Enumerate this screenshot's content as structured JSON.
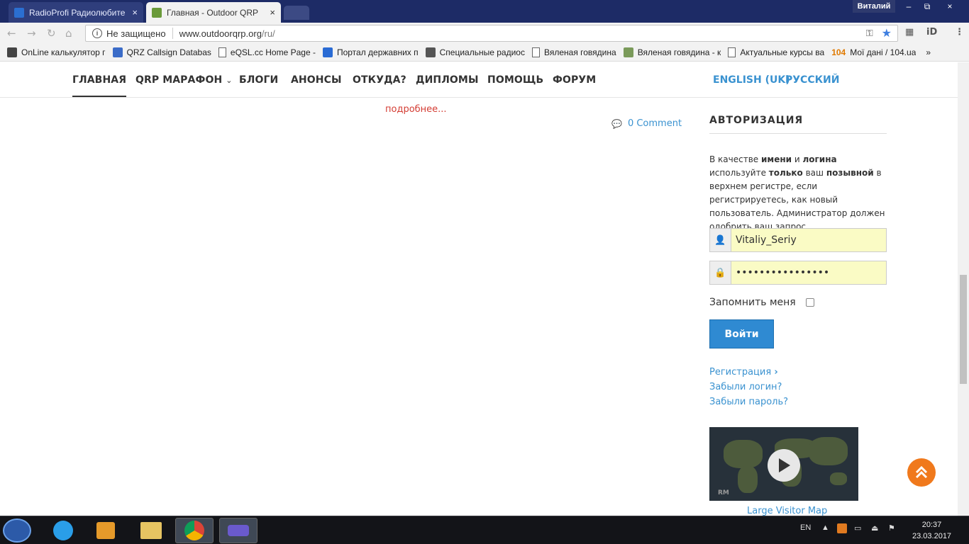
{
  "browser": {
    "tabs": [
      {
        "title": "RadioProfi Радиолюбите",
        "close": "×"
      },
      {
        "title": "Главная - Outdoor QRP",
        "close": "×"
      }
    ],
    "profile_name": "Виталий",
    "window_controls": [
      "–",
      "⧉",
      "×"
    ],
    "security_label": "Не защищено",
    "url_host": "www.outdoorqrp.org",
    "url_path": "/ru/",
    "bookmarks": [
      "OnLine калькулятор г",
      "QRZ Callsign Databas",
      "eQSL.cc Home Page -",
      "Портал державних п",
      "Специальные радиос",
      "Вяленая говядина",
      "Вяленая говядина - к",
      "Актуальные курсы ва"
    ],
    "bookmark_104_num": "104",
    "bookmark_104_text": "Мої дані / 104.ua",
    "bookmarks_more": "»"
  },
  "nav": {
    "items": [
      "ГЛАВНАЯ",
      "QRP МАРАФОН",
      "БЛОГИ",
      "АНОНСЫ",
      "ОТКУДА?",
      "ДИПЛОМЫ",
      "ПОМОЩЬ",
      "ФОРУМ"
    ],
    "languages": [
      "ENGLISH (UK)",
      "РУССКИЙ"
    ]
  },
  "content": {
    "read_more": "подробнее...",
    "comment_count": "0 Comment"
  },
  "auth": {
    "heading": "АВТОРИЗАЦИЯ",
    "info_parts": [
      "В качестве ",
      "имени",
      " и ",
      "логина",
      " используйте ",
      "только",
      " ваш ",
      "позывной",
      " в верхнем регистре, если регистрируетесь, как новый пользователь. Администратор должен одобрить ваш запрос."
    ],
    "username_value": "Vitaliy_Seriy",
    "password_value": "••••••••••••••••",
    "remember_label": "Запомнить меня",
    "login_button": "Войти",
    "register_link": "Регистрация",
    "forgot_login": "Забыли логин?",
    "forgot_password": "Забыли пароль?"
  },
  "map": {
    "caption": "Large Visitor Map",
    "logo": "RM"
  },
  "taskbar": {
    "lang": "EN",
    "time": "20:37",
    "date": "23.03.2017"
  },
  "colors": {
    "accent": "#3a92d0",
    "read_more": "#d43d34",
    "login_button": "#2f8ad2",
    "to_top": "#f0791c"
  }
}
